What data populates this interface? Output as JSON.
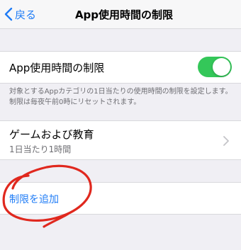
{
  "nav": {
    "back_label": "戻る",
    "title": "App使用時間の制限"
  },
  "limits_toggle": {
    "label": "App使用時間の制限",
    "on": true,
    "color": "#34c759"
  },
  "footnote": "対象とするAppカテゴリの1日当たりの使用時間の制限を設定します。制限は毎夜午前0時にリセットされます。",
  "category": {
    "title": "ゲームおよび教育",
    "subtitle": "1日当たり1時間"
  },
  "add_limit": {
    "label": "制限を追加"
  },
  "colors": {
    "accent": "#1f7cf6",
    "annotation": "#e0281e"
  },
  "icons": [
    "chevron-left-icon",
    "chevron-right-icon"
  ]
}
